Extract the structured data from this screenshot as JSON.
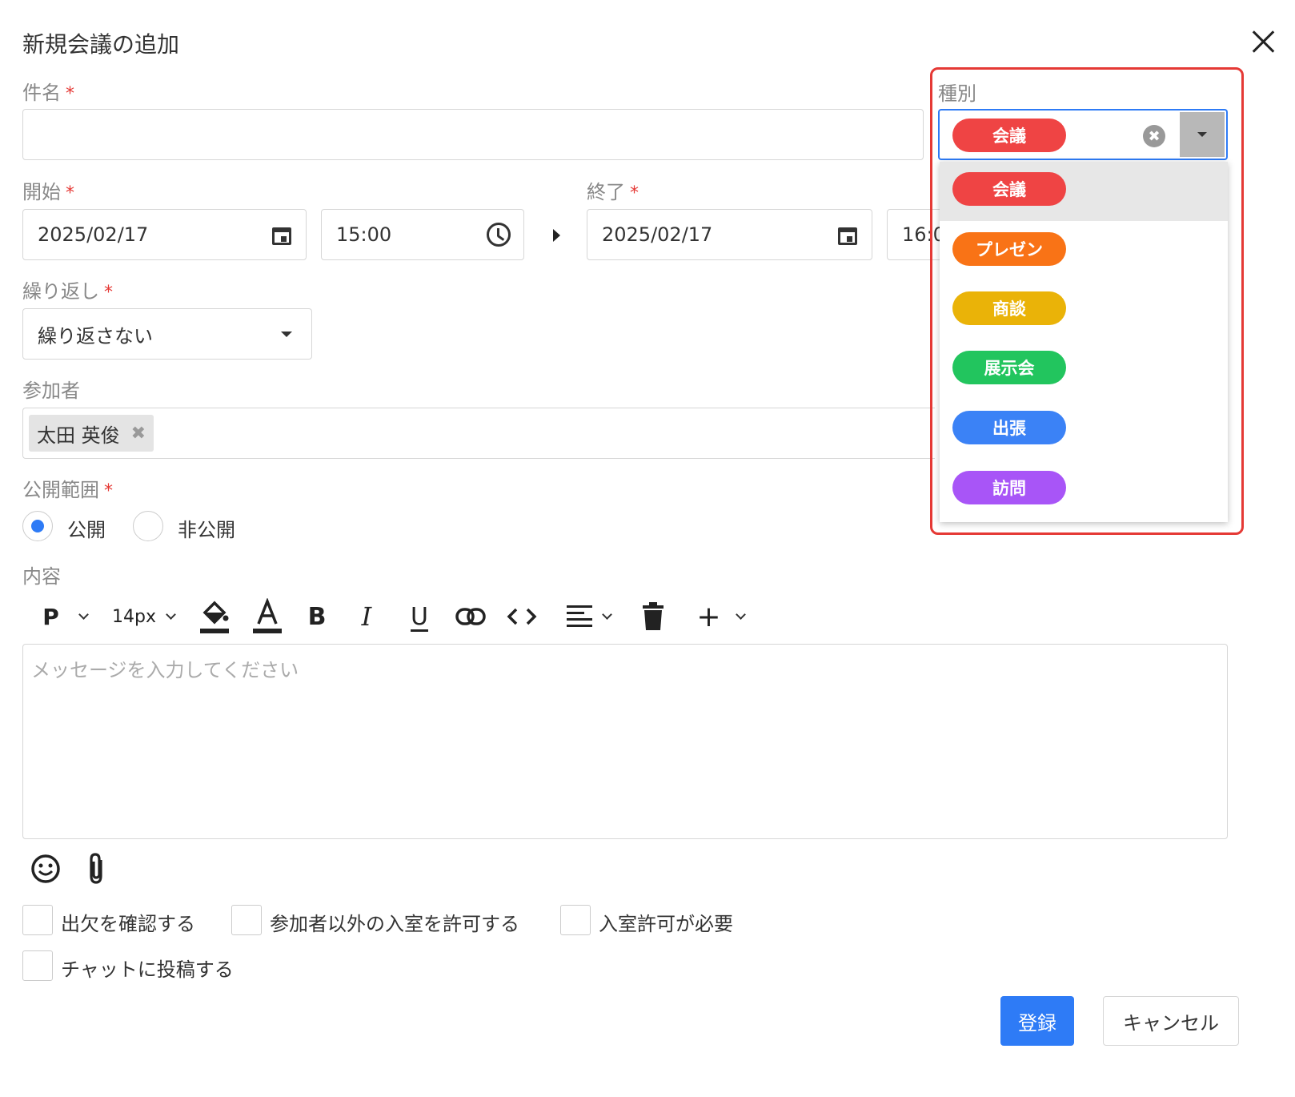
{
  "dialog": {
    "title": "新規会議の追加",
    "close_icon": "close-icon"
  },
  "fields": {
    "subject": {
      "label": "件名",
      "required": "*",
      "value": ""
    },
    "start": {
      "label": "開始",
      "required": "*",
      "date": "2025/02/17",
      "time": "15:00"
    },
    "end": {
      "label": "終了",
      "required": "*",
      "date": "2025/02/17",
      "time": "16:0"
    },
    "repeat": {
      "label": "繰り返し",
      "required": "*",
      "value": "繰り返さない"
    },
    "participants": {
      "label": "参加者",
      "chips": [
        {
          "name": "太田 英俊",
          "remove": "✖"
        }
      ]
    },
    "visibility": {
      "label": "公開範囲",
      "required": "*",
      "options": [
        "公開",
        "非公開"
      ],
      "selected": "公開"
    },
    "content": {
      "label": "内容",
      "placeholder": "メッセージを入力してください",
      "toolbar": {
        "paragraph": "P",
        "font_size": "14px",
        "bold": "B",
        "italic": "I",
        "underline": "U",
        "plus": "+"
      }
    }
  },
  "checkboxes": [
    "出欠を確認する",
    "参加者以外の入室を許可する",
    "入室許可が必要",
    "チャットに投稿する"
  ],
  "buttons": {
    "submit": "登録",
    "cancel": "キャンセル"
  },
  "category": {
    "label": "種別",
    "selected": {
      "name": "会議",
      "color": "#ef4444"
    },
    "clear_icon": "✖",
    "options": [
      {
        "name": "会議",
        "color": "#ef4444"
      },
      {
        "name": "プレゼン",
        "color": "#f97316"
      },
      {
        "name": "商談",
        "color": "#eab308"
      },
      {
        "name": "展示会",
        "color": "#22c55e"
      },
      {
        "name": "出張",
        "color": "#3b82f6"
      },
      {
        "name": "訪問",
        "color": "#a855f7"
      }
    ]
  },
  "colors": {
    "accent": "#2e7bf6",
    "highlight": "#e53935",
    "required": "#e53935"
  }
}
